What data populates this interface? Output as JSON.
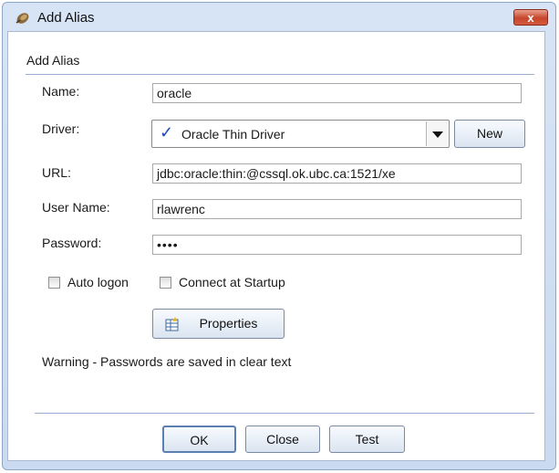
{
  "window": {
    "title": "Add Alias",
    "close_label": "x"
  },
  "section": {
    "label": "Add Alias"
  },
  "fields": {
    "name_label": "Name:",
    "name_value": "oracle",
    "driver_label": "Driver:",
    "driver_value": "Oracle Thin Driver",
    "driver_check": "✓",
    "new_button": "New",
    "url_label": "URL:",
    "url_value": "jdbc:oracle:thin:@cssql.ok.ubc.ca:1521/xe",
    "user_label": "User Name:",
    "user_value": "rlawrenc",
    "password_label": "Password:",
    "password_value": "••••"
  },
  "options": {
    "auto_logon": "Auto logon",
    "connect_startup": "Connect at Startup"
  },
  "properties_button": "Properties",
  "warning": "Warning - Passwords are saved in clear text",
  "footer": {
    "ok": "OK",
    "close": "Close",
    "test": "Test"
  }
}
